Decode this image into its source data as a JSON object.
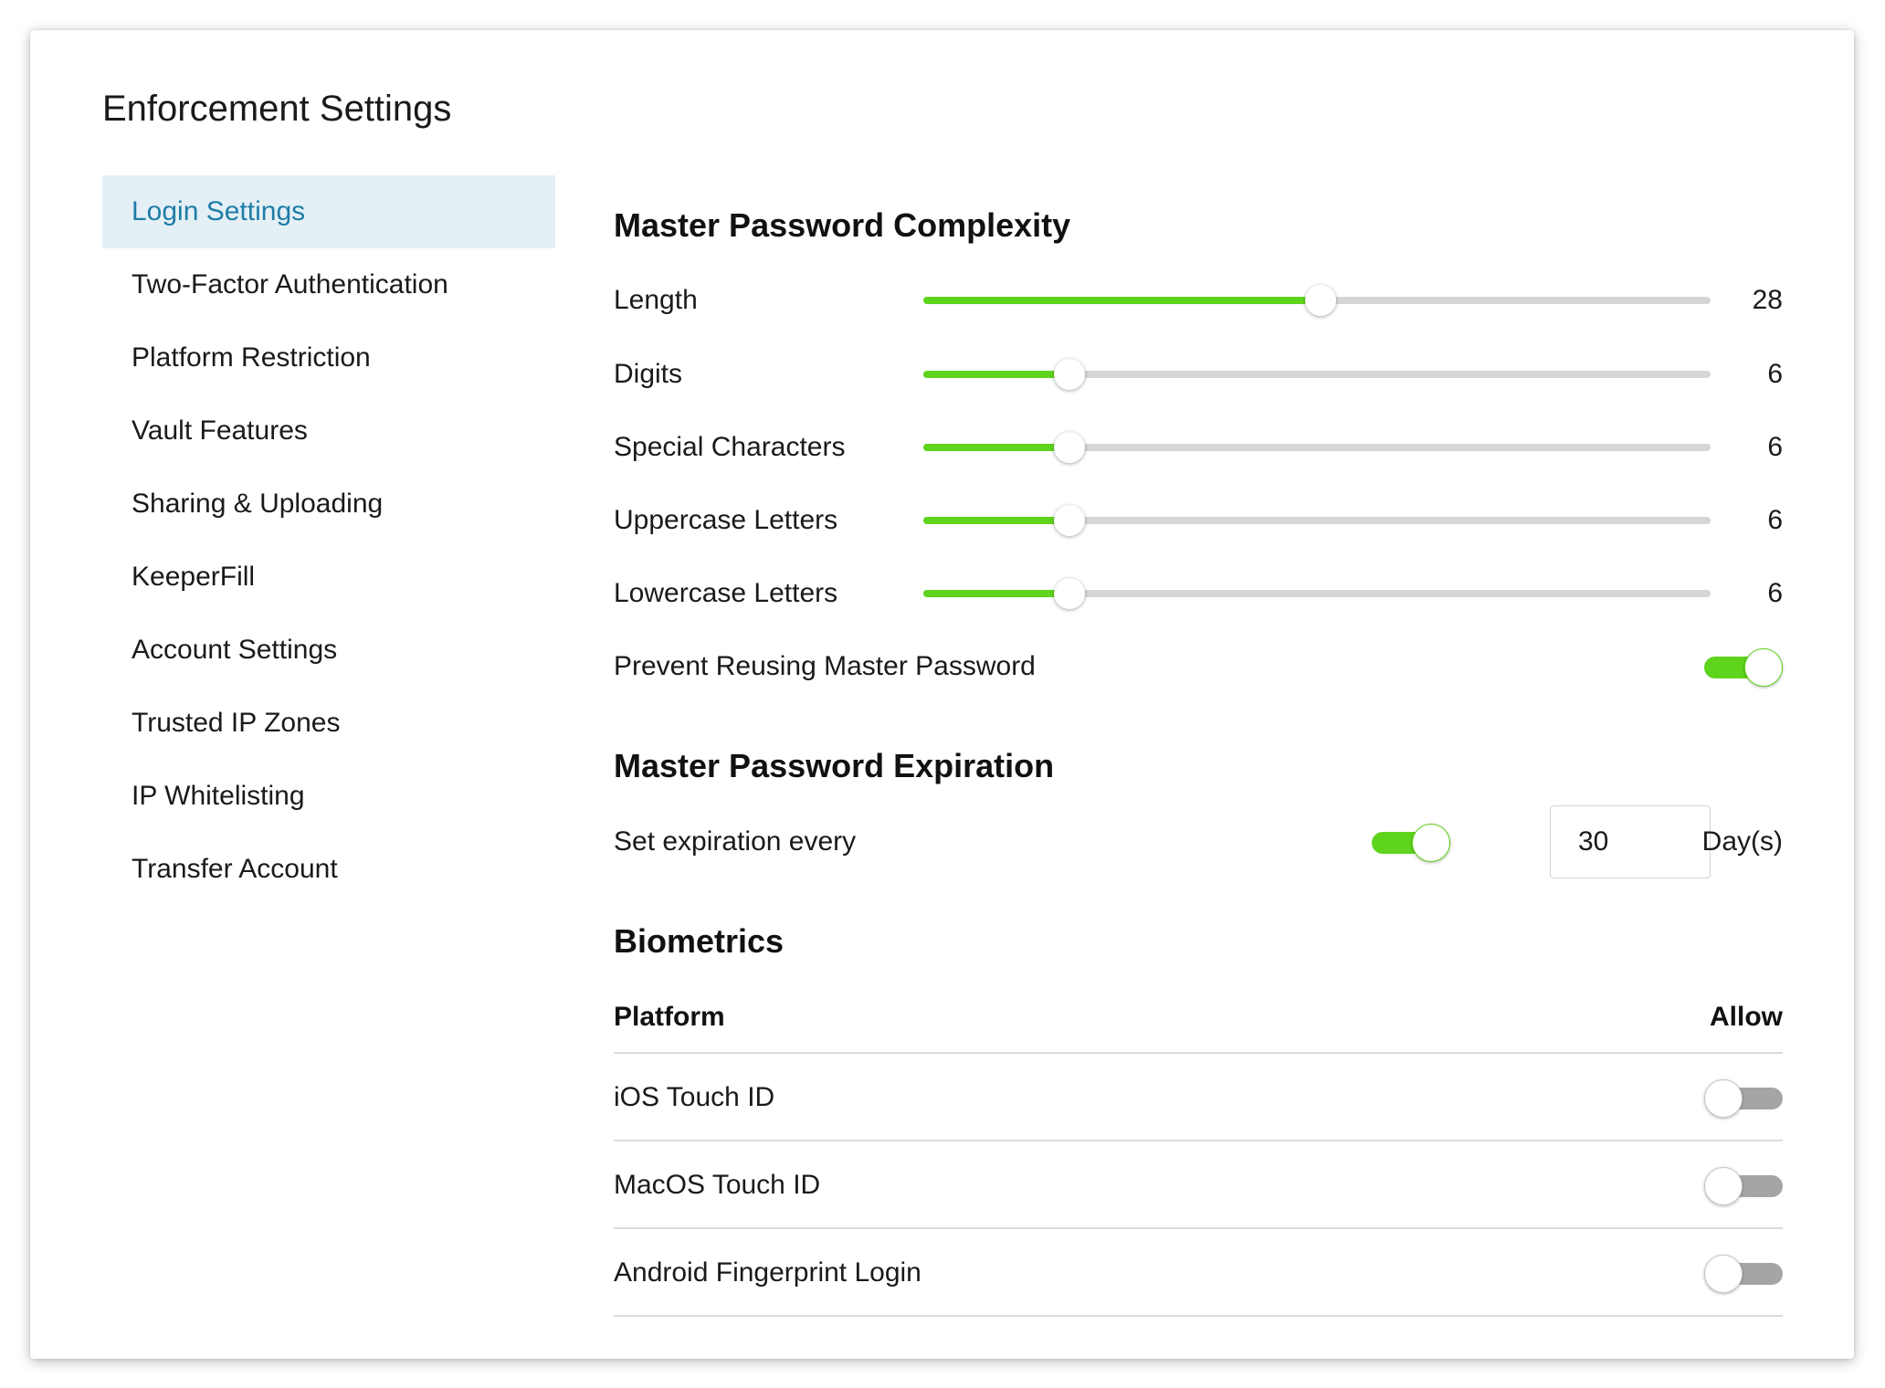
{
  "page": {
    "title": "Enforcement Settings"
  },
  "sidebar": {
    "items": [
      {
        "label": "Login Settings",
        "active": true
      },
      {
        "label": "Two-Factor Authentication",
        "active": false
      },
      {
        "label": "Platform Restriction",
        "active": false
      },
      {
        "label": "Vault Features",
        "active": false
      },
      {
        "label": "Sharing & Uploading",
        "active": false
      },
      {
        "label": "KeeperFill",
        "active": false
      },
      {
        "label": "Account Settings",
        "active": false
      },
      {
        "label": "Trusted IP Zones",
        "active": false
      },
      {
        "label": "IP Whitelisting",
        "active": false
      },
      {
        "label": "Transfer Account",
        "active": false
      }
    ]
  },
  "complexity": {
    "title": "Master Password Complexity",
    "sliders": [
      {
        "label": "Length",
        "value": "28",
        "level": 0.505
      },
      {
        "label": "Digits",
        "value": "6",
        "level": 0.186
      },
      {
        "label": "Special Characters",
        "value": "6",
        "level": 0.186
      },
      {
        "label": "Uppercase Letters",
        "value": "6",
        "level": 0.186
      },
      {
        "label": "Lowercase Letters",
        "value": "6",
        "level": 0.186
      }
    ],
    "prevent_reuse": {
      "label": "Prevent Reusing Master Password",
      "on": true
    }
  },
  "expiration": {
    "title": "Master Password Expiration",
    "label": "Set expiration every",
    "on": true,
    "value": "30",
    "unit": "Day(s)"
  },
  "biometrics": {
    "title": "Biometrics",
    "col_platform": "Platform",
    "col_allow": "Allow",
    "rows": [
      {
        "label": "iOS Touch ID",
        "on": false
      },
      {
        "label": "MacOS Touch ID",
        "on": false
      },
      {
        "label": "Android Fingerprint Login",
        "on": false
      }
    ]
  },
  "colors": {
    "accent_green": "#5fd41d",
    "active_nav_bg": "#e4f0f5",
    "active_nav_text": "#1f7da8",
    "toggle_off": "#a5a5a5"
  }
}
